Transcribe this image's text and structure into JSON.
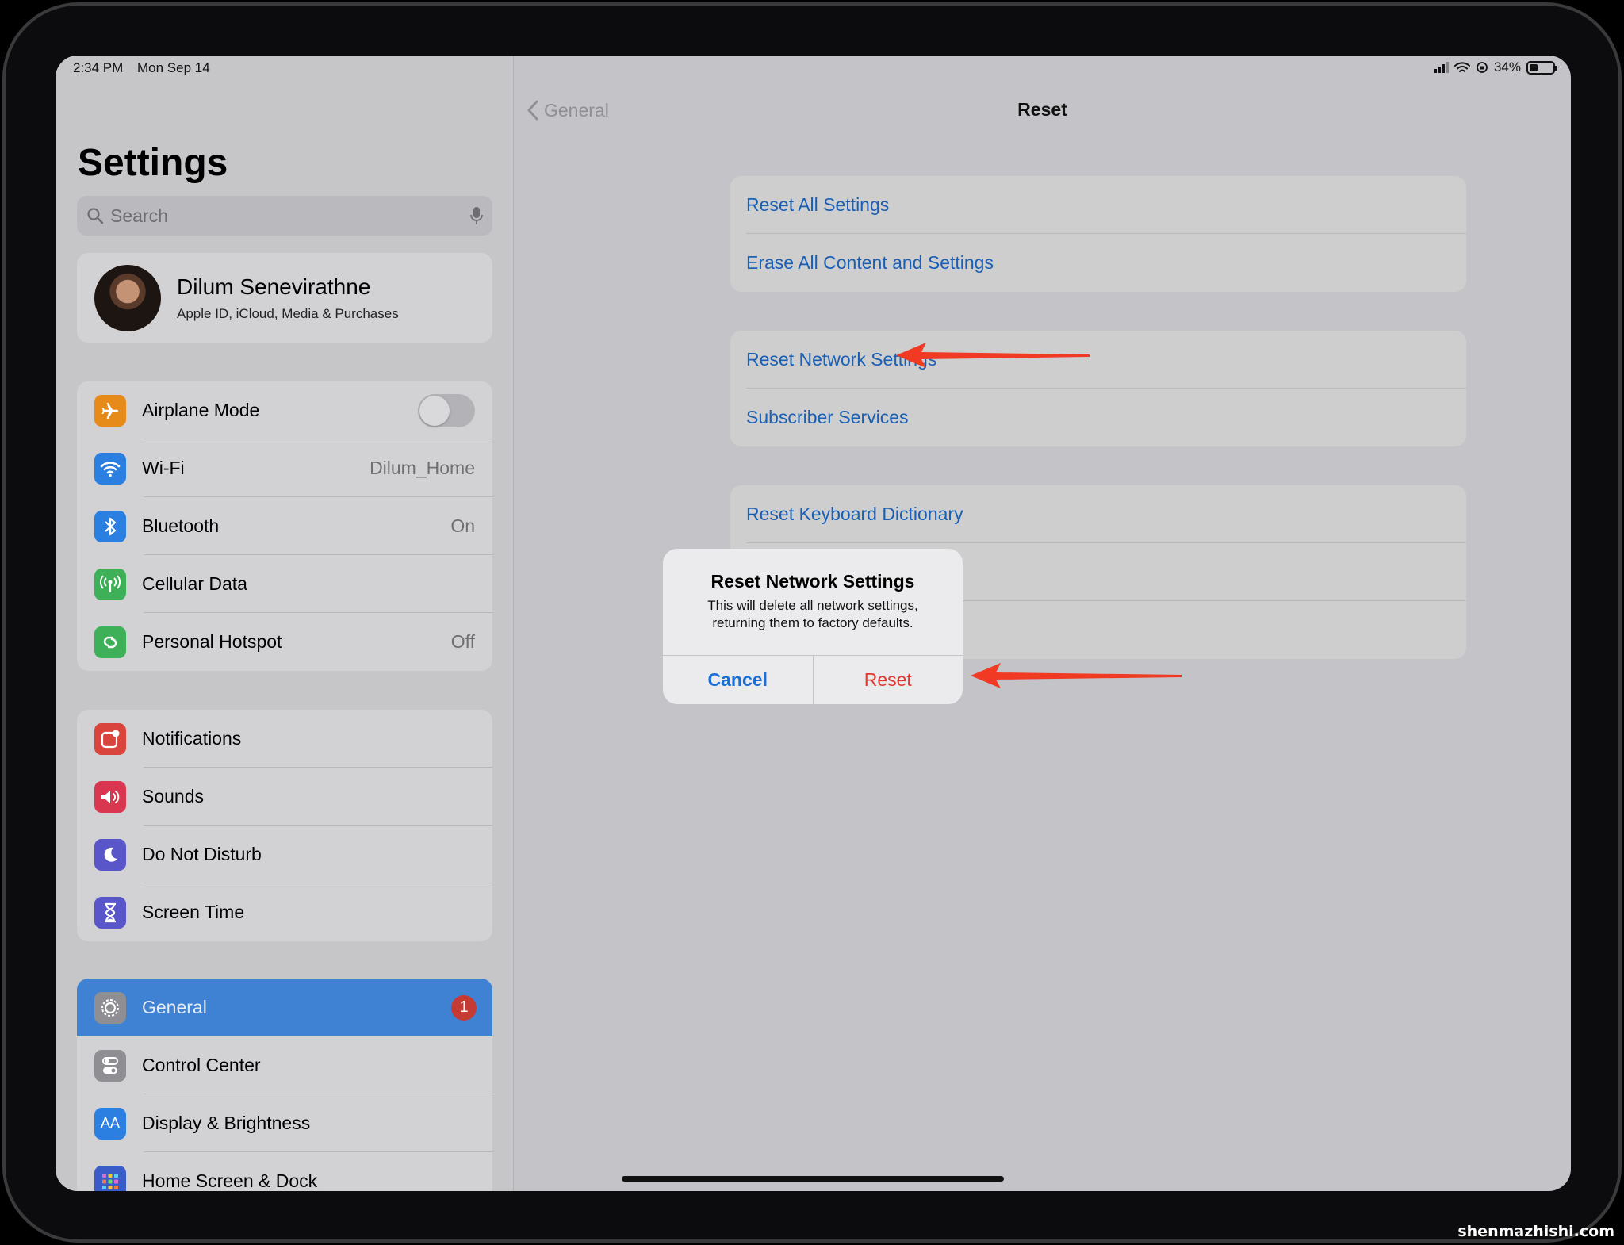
{
  "status_bar": {
    "time": "2:34 PM",
    "date": "Mon Sep 14",
    "battery": "34%"
  },
  "sidebar": {
    "title": "Settings",
    "search_placeholder": "Search",
    "profile": {
      "name": "Dilum Senevirathne",
      "subtitle": "Apple ID, iCloud, Media & Purchases"
    },
    "group1": [
      {
        "label": "Airplane Mode",
        "icon": "airplane-icon",
        "color": "#e68a1a",
        "toggle": false
      },
      {
        "label": "Wi-Fi",
        "icon": "wifi-icon",
        "color": "#2a7fe0",
        "value": "Dilum_Home"
      },
      {
        "label": "Bluetooth",
        "icon": "bluetooth-icon",
        "color": "#2a7fe0",
        "value": "On"
      },
      {
        "label": "Cellular Data",
        "icon": "antenna-icon",
        "color": "#3db058"
      },
      {
        "label": "Personal Hotspot",
        "icon": "hotspot-icon",
        "color": "#3db058",
        "value": "Off"
      }
    ],
    "group2": [
      {
        "label": "Notifications",
        "icon": "notifications-icon",
        "color": "#d9443c"
      },
      {
        "label": "Sounds",
        "icon": "speaker-icon",
        "color": "#d9374f"
      },
      {
        "label": "Do Not Disturb",
        "icon": "moon-icon",
        "color": "#5856c8"
      },
      {
        "label": "Screen Time",
        "icon": "hourglass-icon",
        "color": "#5856c8"
      }
    ],
    "group3": [
      {
        "label": "General",
        "icon": "gear-icon",
        "color": "#8e8e93",
        "badge": "1",
        "selected": true
      },
      {
        "label": "Control Center",
        "icon": "switches-icon",
        "color": "#8e8e93"
      },
      {
        "label": "Display & Brightness",
        "icon": "text-size-icon",
        "color": "#2a7fe0",
        "icon_text": "AA"
      },
      {
        "label": "Home Screen & Dock",
        "icon": "grid-icon",
        "color": "#3a5cc9"
      }
    ]
  },
  "detail": {
    "back_label": "General",
    "title": "Reset",
    "card1": [
      "Reset All Settings",
      "Erase All Content and Settings"
    ],
    "card2": [
      "Reset Network Settings",
      "Subscriber Services"
    ],
    "card3": [
      "Reset Keyboard Dictionary",
      "",
      ""
    ]
  },
  "alert": {
    "title": "Reset Network Settings",
    "message": "This will delete all network settings, returning them to factory defaults.",
    "cancel": "Cancel",
    "confirm": "Reset"
  },
  "annotation_color": "#f03a24",
  "watermark": "shenmazhishi.com"
}
